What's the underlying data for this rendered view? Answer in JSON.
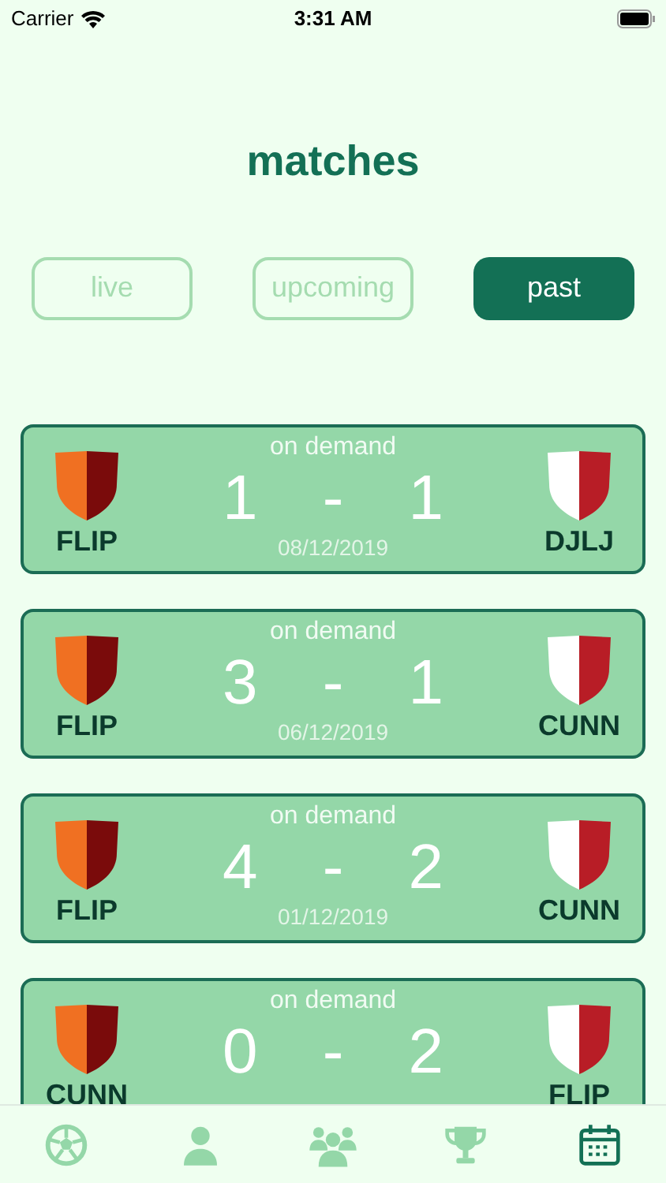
{
  "status_bar": {
    "carrier": "Carrier",
    "time": "3:31 AM"
  },
  "title": "matches",
  "tabs": [
    {
      "label": "live",
      "selected": false
    },
    {
      "label": "upcoming",
      "selected": false
    },
    {
      "label": "past",
      "selected": true
    }
  ],
  "matches": [
    {
      "status": "on demand",
      "home": "FLIP",
      "away": "DJLJ",
      "home_score": "1",
      "separator": "-",
      "away_score": "1",
      "date": "08/12/2019"
    },
    {
      "status": "on demand",
      "home": "FLIP",
      "away": "CUNN",
      "home_score": "3",
      "separator": "-",
      "away_score": "1",
      "date": "06/12/2019"
    },
    {
      "status": "on demand",
      "home": "FLIP",
      "away": "CUNN",
      "home_score": "4",
      "separator": "-",
      "away_score": "2",
      "date": "01/12/2019"
    },
    {
      "status": "on demand",
      "home": "CUNN",
      "away": "FLIP",
      "home_score": "0",
      "separator": "-",
      "away_score": "2"
    }
  ],
  "nav": [
    {
      "kind": "ball",
      "selected": false
    },
    {
      "kind": "person",
      "selected": false
    },
    {
      "kind": "group",
      "selected": false
    },
    {
      "kind": "trophy",
      "selected": false
    },
    {
      "kind": "calendar",
      "selected": true
    }
  ]
}
